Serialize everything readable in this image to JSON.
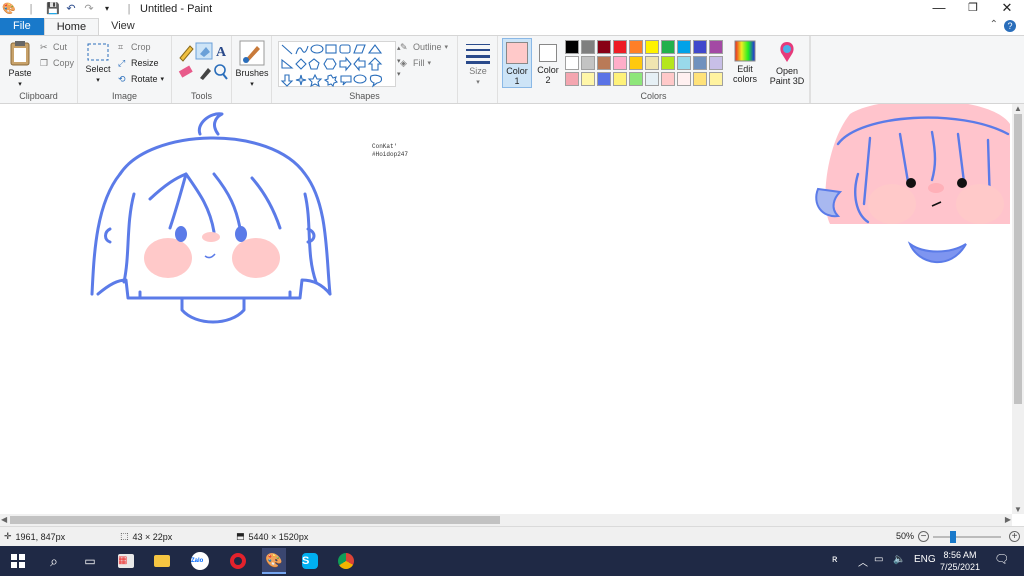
{
  "window": {
    "title": "Untitled - Paint",
    "minimize": "—",
    "restore": "❐",
    "close": "✕"
  },
  "tabs": {
    "file": "File",
    "home": "Home",
    "view": "View"
  },
  "ribbon": {
    "clipboard": {
      "label": "Clipboard",
      "paste": "Paste",
      "cut": "Cut",
      "copy": "Copy"
    },
    "image": {
      "label": "Image",
      "select": "Select",
      "crop": "Crop",
      "resize": "Resize",
      "rotate": "Rotate"
    },
    "tools": {
      "label": "Tools"
    },
    "brushes": {
      "label": "Brushes"
    },
    "shapes": {
      "label": "Shapes",
      "outline": "Outline",
      "fill": "Fill"
    },
    "size": {
      "label": "Size"
    },
    "colors": {
      "label": "Colors",
      "color1_label": "Color",
      "color1_num": "1",
      "color2_label": "Color",
      "color2_num": "2",
      "color1": "#ffc9c9",
      "color2": "#ffffff",
      "edit_label": "Edit",
      "edit_label2": "colors",
      "palette": [
        "#000000",
        "#7f7f7f",
        "#880015",
        "#ed1c24",
        "#ff7f27",
        "#fff200",
        "#22b14c",
        "#00a2e8",
        "#3f48cc",
        "#a349a4",
        "#ffffff",
        "#c3c3c3",
        "#b97a57",
        "#ffaec9",
        "#ffc90e",
        "#efe4b0",
        "#b5e61d",
        "#99d9ea",
        "#7092be",
        "#c8bfe7",
        "#f4a6b0",
        "#fff6a8",
        "#5a73e6",
        "#fff27a",
        "#8ee67a",
        "#e6f0f5",
        "#ffc9c9",
        "#fff0f0",
        "#ffe27a",
        "#fff3a0"
      ]
    },
    "paint3d": {
      "label": "Open",
      "label2": "Paint 3D"
    }
  },
  "canvas": {
    "signature_line1": "ConKat'",
    "signature_line2": "#Hoidop247",
    "outline_color": "#5b7be8",
    "blush_color": "#ffc9c9",
    "hair_pink": "#ffc4cc"
  },
  "status": {
    "cursor_pos": "1961, 847px",
    "selection_size": "43 × 22px",
    "image_size": "5440 × 1520px",
    "zoom": "50%"
  },
  "taskbar": {
    "language": "ENG",
    "time": "8:56 AM",
    "date": "7/25/2021"
  }
}
